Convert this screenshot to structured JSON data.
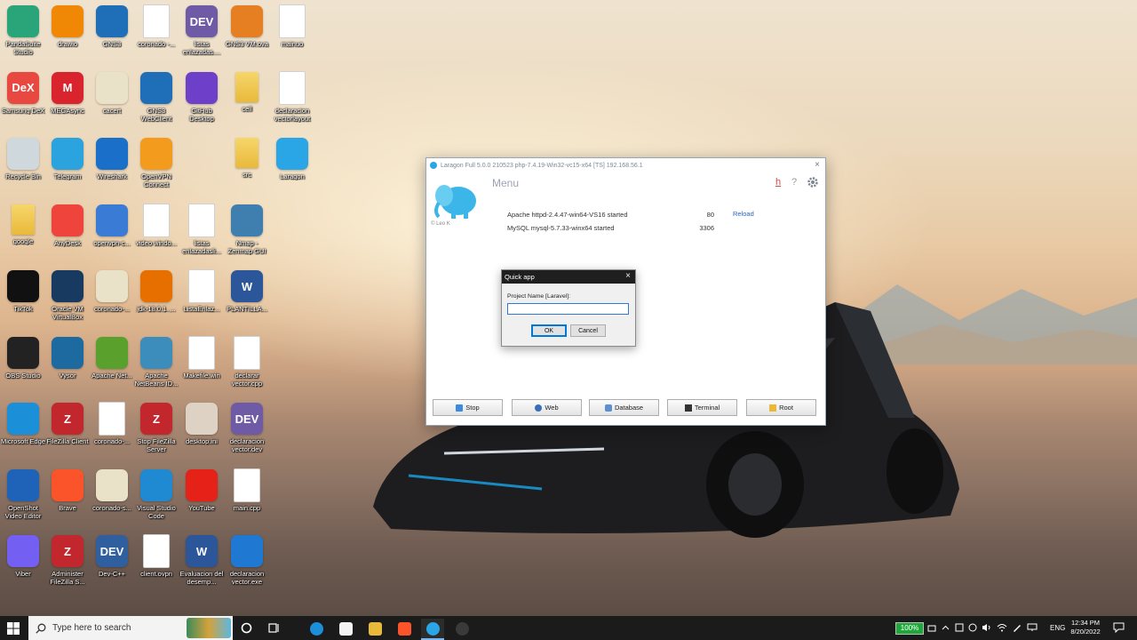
{
  "desktop_icons": [
    {
      "label": "PandaSuite Studio",
      "color": "#2aa57a",
      "glyph": "",
      "col": 0,
      "row": 0
    },
    {
      "label": "drawio",
      "color": "#f08705",
      "glyph": "",
      "col": 1,
      "row": 0
    },
    {
      "label": "GNS3",
      "color": "#1e6fb8",
      "glyph": "",
      "col": 2,
      "row": 0
    },
    {
      "label": "coronado -...",
      "color": "doc",
      "glyph": "",
      "col": 3,
      "row": 0
    },
    {
      "label": "listas enlazadas....",
      "color": "#6f5aa6",
      "glyph": "DEV",
      "col": 4,
      "row": 0
    },
    {
      "label": "GNS3 VM.ova",
      "color": "#e67e22",
      "glyph": "",
      "col": 5,
      "row": 0
    },
    {
      "label": "mainuo",
      "color": "doc",
      "glyph": "",
      "col": 6,
      "row": 0
    },
    {
      "label": "Samsung DeX",
      "color": "#e8483f",
      "glyph": "DeX",
      "col": 0,
      "row": 1
    },
    {
      "label": "MEGAsync",
      "color": "#d9232d",
      "glyph": "M",
      "col": 1,
      "row": 1
    },
    {
      "label": "cacert",
      "color": "#e9e1c8",
      "glyph": "",
      "col": 2,
      "row": 1
    },
    {
      "label": "GNS3 WebClient",
      "color": "#1e6fb8",
      "glyph": "",
      "col": 3,
      "row": 1
    },
    {
      "label": "GitHub Desktop",
      "color": "#6e40c9",
      "glyph": "",
      "col": 4,
      "row": 1
    },
    {
      "label": "cell",
      "color": "folder",
      "glyph": "",
      "col": 5,
      "row": 1
    },
    {
      "label": "declaracion vectorlayout",
      "color": "doc",
      "glyph": "",
      "col": 6,
      "row": 1
    },
    {
      "label": "Recycle Bin",
      "color": "#cfd8dc",
      "glyph": "",
      "col": 0,
      "row": 2
    },
    {
      "label": "Telegram",
      "color": "#2aa3df",
      "glyph": "",
      "col": 1,
      "row": 2
    },
    {
      "label": "Wireshark",
      "color": "#1a6fc9",
      "glyph": "",
      "col": 2,
      "row": 2
    },
    {
      "label": "OpenVPN Connect",
      "color": "#f29b1d",
      "glyph": "",
      "col": 3,
      "row": 2
    },
    {
      "label": "src",
      "color": "folder",
      "glyph": "",
      "col": 5,
      "row": 2
    },
    {
      "label": "Laragon",
      "color": "#2aa6e6",
      "glyph": "",
      "col": 6,
      "row": 2
    },
    {
      "label": "google",
      "color": "folder",
      "glyph": "",
      "col": 0,
      "row": 3
    },
    {
      "label": "AnyDesk",
      "color": "#ef443b",
      "glyph": "",
      "col": 1,
      "row": 3
    },
    {
      "label": "openvpn-c...",
      "color": "#3a7bd5",
      "glyph": "",
      "col": 2,
      "row": 3
    },
    {
      "label": "video windo...",
      "color": "doc",
      "glyph": "",
      "col": 3,
      "row": 3
    },
    {
      "label": "listas enlazadasli...",
      "color": "doc",
      "glyph": "",
      "col": 4,
      "row": 3
    },
    {
      "label": "Nmap - Zenmap GUI",
      "color": "#3e7fb0",
      "glyph": "",
      "col": 5,
      "row": 3
    },
    {
      "label": "TikTok",
      "color": "#111111",
      "glyph": "",
      "col": 0,
      "row": 4
    },
    {
      "label": "Oracle VM VirtualBox",
      "color": "#183a61",
      "glyph": "",
      "col": 1,
      "row": 4
    },
    {
      "label": "coronado-...",
      "color": "#e9e1c8",
      "glyph": "",
      "col": 2,
      "row": 4
    },
    {
      "label": "jdk-18.0.1_...",
      "color": "#e76f00",
      "glyph": "",
      "col": 3,
      "row": 4
    },
    {
      "label": "ListaEnlaz...",
      "color": "doc",
      "glyph": "",
      "col": 4,
      "row": 4
    },
    {
      "label": "PLANTILLA...",
      "color": "#2b579a",
      "glyph": "W",
      "col": 5,
      "row": 4
    },
    {
      "label": "OBS Studio",
      "color": "#222222",
      "glyph": "",
      "col": 0,
      "row": 5
    },
    {
      "label": "Vysor",
      "color": "#1d6aa0",
      "glyph": "",
      "col": 1,
      "row": 5
    },
    {
      "label": "Apache Net...",
      "color": "#5aa02c",
      "glyph": "",
      "col": 2,
      "row": 5
    },
    {
      "label": "Apache NetBeans ID...",
      "color": "#3c8dbc",
      "glyph": "",
      "col": 3,
      "row": 5
    },
    {
      "label": "Makefile.win",
      "color": "doc",
      "glyph": "",
      "col": 4,
      "row": 5
    },
    {
      "label": "declarar vector.cpp",
      "color": "doc",
      "glyph": "",
      "col": 5,
      "row": 5
    },
    {
      "label": "Microsoft Edge",
      "color": "#1b8fd8",
      "glyph": "",
      "col": 0,
      "row": 6
    },
    {
      "label": "FileZilla Client",
      "color": "#c1272d",
      "glyph": "Z",
      "col": 1,
      "row": 6
    },
    {
      "label": "coronado-...",
      "color": "doc",
      "glyph": "",
      "col": 2,
      "row": 6
    },
    {
      "label": "Stop FileZilla Server",
      "color": "#c1272d",
      "glyph": "Z",
      "col": 3,
      "row": 6
    },
    {
      "label": "desktop.ini",
      "color": "#ddd2c4",
      "glyph": "",
      "col": 4,
      "row": 6
    },
    {
      "label": "declaracion vector.dev",
      "color": "#6f5aa6",
      "glyph": "DEV",
      "col": 5,
      "row": 6
    },
    {
      "label": "OpenShot Video Editor",
      "color": "#1e63b8",
      "glyph": "",
      "col": 0,
      "row": 7
    },
    {
      "label": "Brave",
      "color": "#fb542b",
      "glyph": "",
      "col": 1,
      "row": 7
    },
    {
      "label": "coronado-s...",
      "color": "#e9e1c8",
      "glyph": "",
      "col": 2,
      "row": 7
    },
    {
      "label": "Visual Studio Code",
      "color": "#1f8ad2",
      "glyph": "",
      "col": 3,
      "row": 7
    },
    {
      "label": "YouTube",
      "color": "#e62117",
      "glyph": "",
      "col": 4,
      "row": 7
    },
    {
      "label": "main.cpp",
      "color": "doc",
      "glyph": "",
      "col": 5,
      "row": 7
    },
    {
      "label": "Viber",
      "color": "#7360f2",
      "glyph": "",
      "col": 0,
      "row": 8
    },
    {
      "label": "Administer FileZilla S...",
      "color": "#c1272d",
      "glyph": "Z",
      "col": 1,
      "row": 8
    },
    {
      "label": "Dev-C++",
      "color": "#2f5f9e",
      "glyph": "DEV",
      "col": 2,
      "row": 8
    },
    {
      "label": "client.ovpn",
      "color": "doc",
      "glyph": "",
      "col": 3,
      "row": 8
    },
    {
      "label": "Evaluacion del desemp...",
      "color": "#2b579a",
      "glyph": "W",
      "col": 4,
      "row": 8
    },
    {
      "label": "declaracion vector.exe",
      "color": "#1f78d1",
      "glyph": "",
      "col": 5,
      "row": 8
    }
  ],
  "laragon": {
    "title": "Laragon Full 5.0.0 210523 php-7.4.19-Win32-vc15-x64 [TS]  192.168.56.1",
    "close": "×",
    "menu": "Menu",
    "help_h": "h",
    "help_q": "?",
    "logo_caption": "© Leo K",
    "services": [
      {
        "name": "Apache httpd-2.4.47-win64-VS16 started",
        "port": "80"
      },
      {
        "name": "MySQL mysql-5.7.33-winx64 started",
        "port": "3306"
      }
    ],
    "reload": "Reload",
    "buttons": [
      {
        "label": "Stop",
        "icon": "stop-icon",
        "color": "#3d8be0"
      },
      {
        "label": "Web",
        "icon": "globe-icon",
        "color": "#3a6fb5"
      },
      {
        "label": "Database",
        "icon": "database-icon",
        "color": "#5c90cf"
      },
      {
        "label": "Terminal",
        "icon": "terminal-icon",
        "color": "#333333"
      },
      {
        "label": "Root",
        "icon": "folder-icon",
        "color": "#e9b93a"
      }
    ]
  },
  "quick_app": {
    "title": "Quick app",
    "close": "×",
    "label": "Project Name [Laravel]:",
    "value": "",
    "ok": "OK",
    "cancel": "Cancel"
  },
  "taskbar": {
    "search_placeholder": "Type here to search",
    "battery": "100%",
    "language": "ENG",
    "time": "12:34 PM",
    "date": "8/20/2022",
    "apps": [
      {
        "name": "edge",
        "color": "#1b8fd8"
      },
      {
        "name": "store",
        "color": "#f3f3f3"
      },
      {
        "name": "file-explorer",
        "color": "#e9b93a"
      },
      {
        "name": "brave",
        "color": "#fb542b"
      },
      {
        "name": "laragon",
        "color": "#2aa6e6"
      },
      {
        "name": "obs",
        "color": "#3a3a3a"
      }
    ]
  }
}
